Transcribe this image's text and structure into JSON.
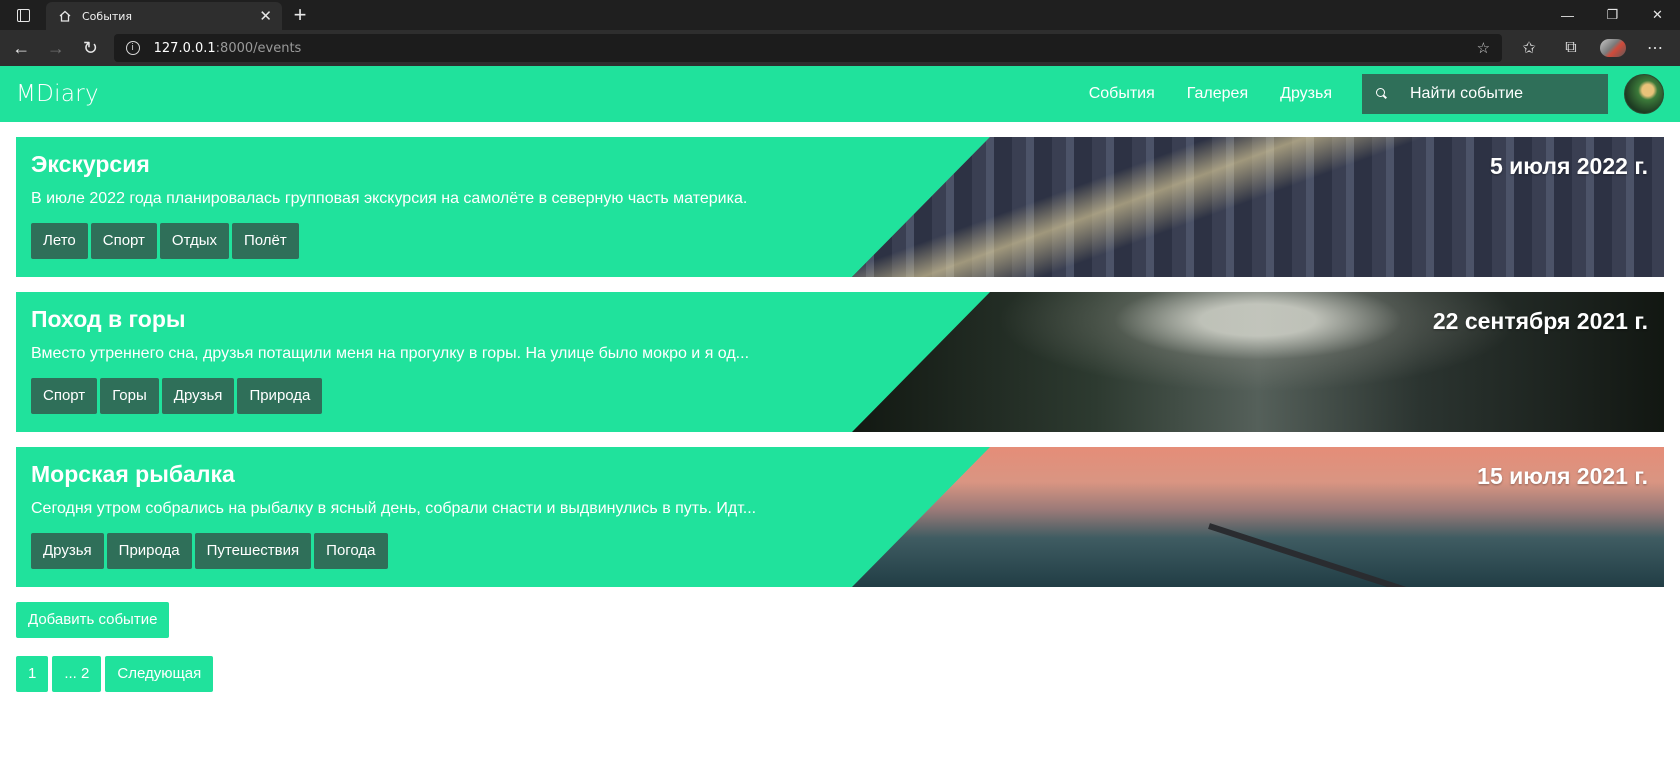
{
  "browser": {
    "tab_title": "События",
    "url_host": "127.0.0.1",
    "url_rest": ":8000/events"
  },
  "site": {
    "brand": "MDiary",
    "nav": [
      "События",
      "Галерея",
      "Друзья"
    ],
    "search_placeholder": "Найти событие",
    "accent_color": "#20e29c",
    "dark_color": "#2f6f59"
  },
  "events": [
    {
      "title": "Экскурсия",
      "description": "В июле 2022 года планировалась групповая экскурсия на самолёте в северную часть материка.",
      "date": "5 июля 2022 г.",
      "tags": [
        "Лето",
        "Спорт",
        "Отдых",
        "Полёт"
      ],
      "image": "city"
    },
    {
      "title": "Поход в горы",
      "description": "Вместо утреннего сна, друзья потащили меня на прогулку в горы. На улице было мокро и я од...",
      "date": "22 сентября 2021 г.",
      "tags": [
        "Спорт",
        "Горы",
        "Друзья",
        "Природа"
      ],
      "image": "mountains"
    },
    {
      "title": "Морская рыбалка",
      "description": "Сегодня утром собрались на рыбалку в ясный день, собрали снасти и выдвинулись в путь. Идт...",
      "date": "15 июля 2021 г.",
      "tags": [
        "Друзья",
        "Природа",
        "Путешествия",
        "Погода"
      ],
      "image": "sea"
    }
  ],
  "add_event_label": "Добавить событие",
  "pagination": [
    "1",
    "... 2",
    "Следующая"
  ]
}
